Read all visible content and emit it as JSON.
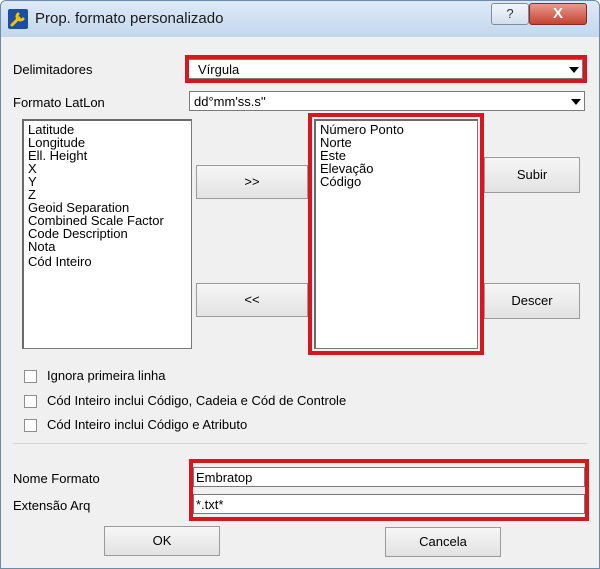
{
  "window": {
    "title": "Prop. formato personalizado",
    "help_glyph": "?",
    "close_glyph": "X"
  },
  "delimiters": {
    "label": "Delimitadores",
    "value": "Vírgula"
  },
  "latlon": {
    "label": "Formato LatLon",
    "value": "dd°mm'ss.s''"
  },
  "available_fields": [
    "Latitude",
    "Longitude",
    "Ell. Height",
    "X",
    "Y",
    "Z",
    "Geoid Separation",
    "Combined Scale Factor",
    "Code Description",
    "Nota",
    "Cód Inteiro"
  ],
  "selected_fields": [
    "Número Ponto",
    "Norte",
    "Este",
    "Elevação",
    "Código"
  ],
  "buttons": {
    "add": ">>",
    "remove": "<<",
    "move_up": "Subir",
    "move_down": "Descer",
    "ok": "OK",
    "cancel": "Cancela"
  },
  "options": {
    "ignore_first_line": "Ignora primeira linha",
    "code_includes_chain": "Cód Inteiro inclui Código, Cadeia e Cód de Controle",
    "code_includes_attribute": "Cód Inteiro inclui Código e Atributo"
  },
  "format_name": {
    "label": "Nome Formato",
    "value": "Embratop"
  },
  "file_extension": {
    "label": "Extensão Arq",
    "value": "*.txt*"
  },
  "colors": {
    "highlight": "#d6171f",
    "title_bar": "#c3d7ee",
    "close": "#c64333"
  }
}
